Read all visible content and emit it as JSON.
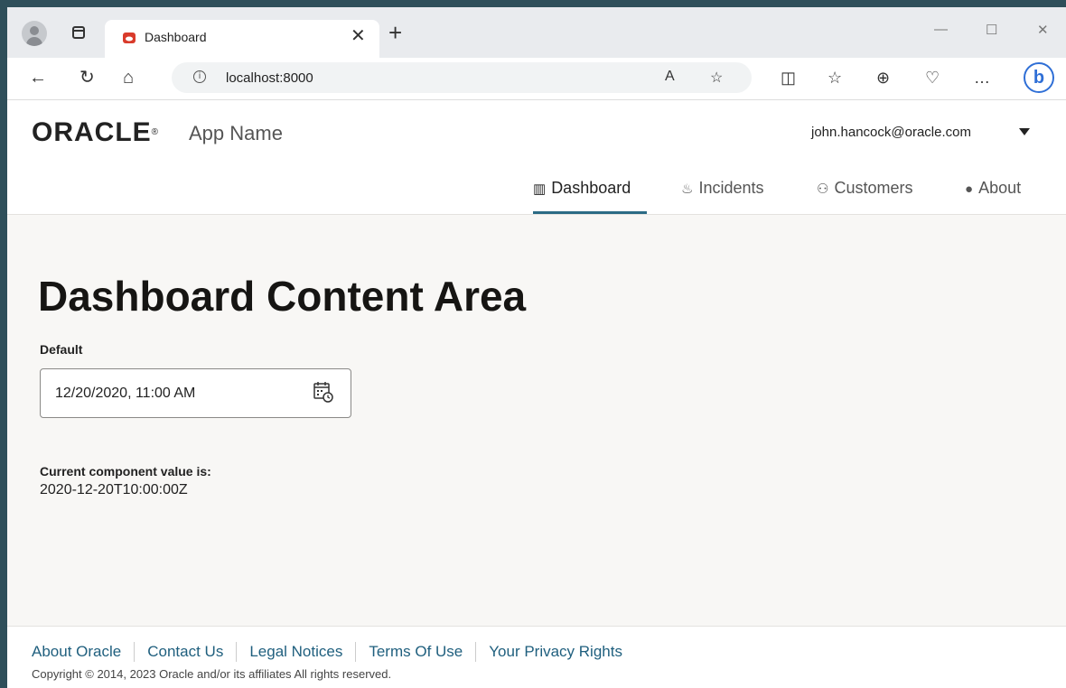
{
  "browser": {
    "tab_title": "Dashboard",
    "tab_close": "✕",
    "new_tab": "+",
    "url": "localhost:8000",
    "window_controls": {
      "minimize": "—",
      "maximize": "☐",
      "close": "✕"
    },
    "toolbar_icons": [
      "read-aloud-icon",
      "favorite-star-icon",
      "split-screen-icon",
      "favorites-list-icon",
      "collections-icon",
      "browser-essentials-icon",
      "more-icon",
      "bing-icon"
    ]
  },
  "app": {
    "logo_text": "ORACLE",
    "logo_mark": "®",
    "app_name": "App Name",
    "user_email": "john.hancock@oracle.com",
    "nav": [
      {
        "label": "Dashboard",
        "icon": "📊",
        "active": true
      },
      {
        "label": "Incidents",
        "icon": "🔥",
        "active": false
      },
      {
        "label": "Customers",
        "icon": "👥",
        "active": false
      },
      {
        "label": "About",
        "icon": "ℹ",
        "active": false
      }
    ]
  },
  "main": {
    "heading": "Dashboard Content Area",
    "field_label": "Default",
    "datetime_value": "12/20/2020, 11:00 AM",
    "current_label": "Current component value is:",
    "current_value": "2020-12-20T10:00:00Z"
  },
  "footer": {
    "links": [
      "About Oracle",
      "Contact Us",
      "Legal Notices",
      "Terms Of Use",
      "Your Privacy Rights"
    ],
    "copyright": "Copyright © 2014, 2023 Oracle and/or its affiliates All rights reserved."
  },
  "colors": {
    "accent": "#2b6b85",
    "link": "#1f5f7e",
    "content_bg": "#f8f7f5"
  }
}
